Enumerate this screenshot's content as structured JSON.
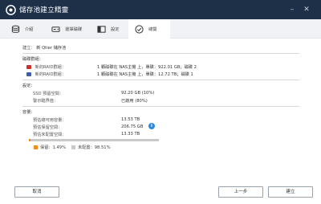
{
  "window": {
    "title": "儲存池建立精靈"
  },
  "steps": [
    {
      "label": "介紹",
      "icon": "database-icon"
    },
    {
      "label": "選擇磁碟",
      "icon": "drive-icon"
    },
    {
      "label": "設定",
      "icon": "settings-panel-icon"
    },
    {
      "label": "總覽",
      "icon": "check-circle-icon"
    }
  ],
  "summary": {
    "create_label": "建立：",
    "create_value": "新 Qtier 儲存池",
    "raid_section": "磁碟群組：",
    "raid_groups": [
      {
        "name": "新的RAID群組：",
        "desc": "1 顆磁碟在 NAS主機 上，單碟：922.01 GB；磁碟 2",
        "color": "#c9302c"
      },
      {
        "name": "新的RAID群組：",
        "desc": "1 顆磁碟在 NAS主機 上，單碟：12.72 TB；磁碟 1",
        "color": "#3b5ea8"
      }
    ],
    "settings_section": "設定：",
    "ssd_label": "SSD 預留空間：",
    "ssd_value": "92.20 GB (10%)",
    "threshold_label": "警示臨界值：",
    "threshold_value": "已啟用 (80%)",
    "capacity_section": "容量：",
    "est_label": "預估總可用容量：",
    "est_value": "13.53 TB",
    "guaranteed_label": "預估保留空間：",
    "guaranteed_value": "206.75 GB",
    "unallocated_label": "預估未配置空間：",
    "unallocated_value": "13.33 TB",
    "bar_used_fraction": 0.0149,
    "legend_reserved": "保留：1.49%",
    "legend_unallocated": "未配置：98.51%"
  },
  "footer": {
    "cancel": "取消",
    "back": "上一步",
    "create": "建立"
  },
  "colors": {
    "titlebar": "#1e2f48",
    "accent": "#2c89e0",
    "reserved": "#f08b1d",
    "unallocated": "#c9c9c9"
  }
}
